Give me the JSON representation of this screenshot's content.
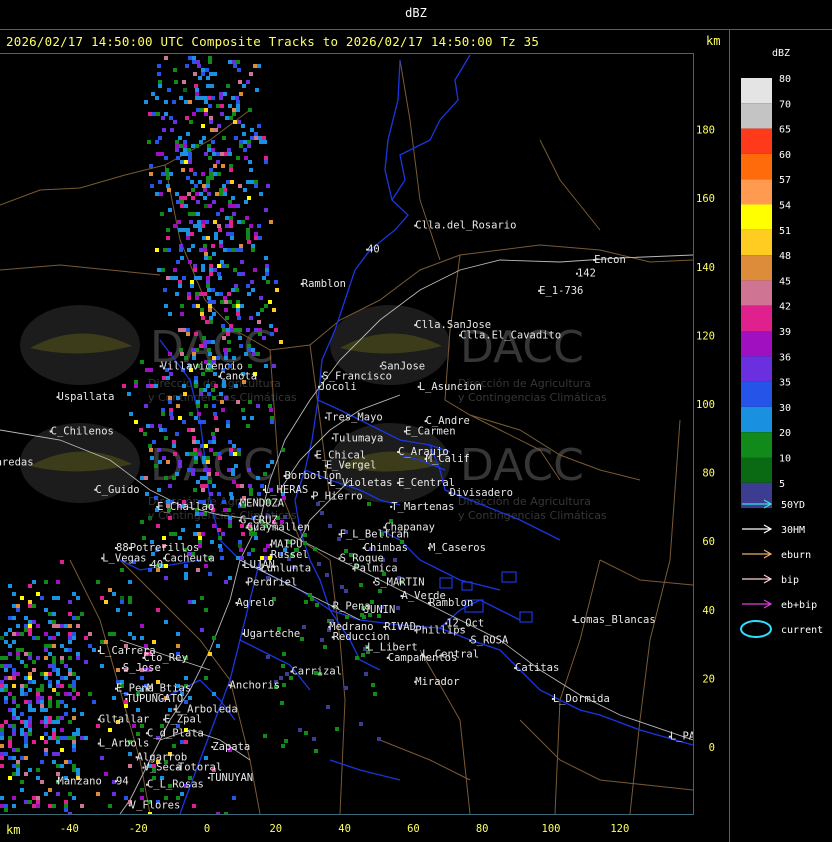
{
  "header": {
    "product": "dBZ"
  },
  "title": {
    "line": "2026/02/17 14:50:00 UTC Composite Tracks to 2026/02/17 14:50:00 Tz 35",
    "km_top": "km",
    "km_bottom": "km"
  },
  "watermark": {
    "brand": "DACC",
    "line1": "Dirección de Agricultura",
    "line2": "y Contingencias Climáticas"
  },
  "axes": {
    "x_ticks": [
      -40,
      -20,
      0,
      20,
      40,
      60,
      80,
      100,
      120
    ],
    "y_ticks": [
      180,
      160,
      140,
      120,
      100,
      80,
      60,
      40,
      20,
      0
    ],
    "x_range_km": [
      -60,
      142
    ],
    "y_range_km": [
      -20,
      200
    ]
  },
  "legend": {
    "title": "dBZ",
    "scale": [
      {
        "label": "80",
        "color": "#e4e4e4"
      },
      {
        "label": "70",
        "color": "#c4c4c4"
      },
      {
        "label": "65",
        "color": "#ff3a1a"
      },
      {
        "label": "60",
        "color": "#ff6a0a"
      },
      {
        "label": "57",
        "color": "#ff9a50"
      },
      {
        "label": "54",
        "color": "#ffff00"
      },
      {
        "label": "51",
        "color": "#ffcc22"
      },
      {
        "label": "48",
        "color": "#dd8c3a"
      },
      {
        "label": "45",
        "color": "#d07494"
      },
      {
        "label": "42",
        "color": "#e0208c"
      },
      {
        "label": "39",
        "color": "#a010c0"
      },
      {
        "label": "36",
        "color": "#6a30e0"
      },
      {
        "label": "35",
        "color": "#2454e8"
      },
      {
        "label": "30",
        "color": "#1a90e0"
      },
      {
        "label": "20",
        "color": "#118a1a"
      },
      {
        "label": "10",
        "color": "#0a6a14"
      },
      {
        "label": "5",
        "color": "#3c3c90"
      }
    ],
    "tracks": [
      {
        "label": "50YD",
        "color": "#40e0e0"
      },
      {
        "label": "30HM",
        "color": "#ffffff"
      },
      {
        "label": "eburn",
        "color": "#e8b070"
      },
      {
        "label": "bip",
        "color": "#ffd0d8"
      },
      {
        "label": "eb+bip",
        "color": "#e040e0"
      }
    ],
    "current": {
      "label": "current",
      "color": "#2ee0ff"
    }
  },
  "places": [
    {
      "name": "Clla.del_Rosario",
      "x": 62,
      "y": 152
    },
    {
      "name": "Encon",
      "x": 114,
      "y": 142
    },
    {
      "name": "142",
      "x": 109,
      "y": 138
    },
    {
      "name": "E_1-736",
      "x": 98,
      "y": 133
    },
    {
      "name": "Ramblon",
      "x": 29,
      "y": 135
    },
    {
      "name": "Clla.SanJose",
      "x": 62,
      "y": 123
    },
    {
      "name": "Clla.El_Cavadito",
      "x": 75,
      "y": 120
    },
    {
      "name": "Villavicencio",
      "x": -12,
      "y": 111
    },
    {
      "name": "S_Francisco",
      "x": 35,
      "y": 108
    },
    {
      "name": "SanJose",
      "x": 52,
      "y": 111
    },
    {
      "name": "Canota",
      "x": 5,
      "y": 108
    },
    {
      "name": "Jocoli",
      "x": 34,
      "y": 105
    },
    {
      "name": "L_Asuncion",
      "x": 63,
      "y": 105
    },
    {
      "name": "Uspallata",
      "x": -42,
      "y": 102
    },
    {
      "name": "Tres_Mayo",
      "x": 36,
      "y": 96
    },
    {
      "name": "C_Andre",
      "x": 65,
      "y": 95
    },
    {
      "name": "E_Carmen",
      "x": 59,
      "y": 92
    },
    {
      "name": "C_Chilenos",
      "x": -44,
      "y": 92
    },
    {
      "name": "Tulumaya",
      "x": 38,
      "y": 90
    },
    {
      "name": "C_Araujo",
      "x": 57,
      "y": 86
    },
    {
      "name": "E_Chical",
      "x": 33,
      "y": 85
    },
    {
      "name": "M_Calif",
      "x": 65,
      "y": 84
    },
    {
      "name": "E_Vergel",
      "x": 36,
      "y": 82
    },
    {
      "name": "Borbollon",
      "x": 24,
      "y": 79
    },
    {
      "name": "E_Central",
      "x": 57,
      "y": 77
    },
    {
      "name": "L_Violetas",
      "x": 37,
      "y": 77
    },
    {
      "name": "Divisadero",
      "x": 72,
      "y": 74
    },
    {
      "name": "L_HERAS",
      "x": 18,
      "y": 75
    },
    {
      "name": "C_Guido",
      "x": -31,
      "y": 75
    },
    {
      "name": "P_Hierro",
      "x": 32,
      "y": 73
    },
    {
      "name": "E_Challao",
      "x": -13,
      "y": 70
    },
    {
      "name": "MENDOZA",
      "x": 11,
      "y": 71
    },
    {
      "name": "T_Martenas",
      "x": 55,
      "y": 70
    },
    {
      "name": "G_CRUZ",
      "x": 11,
      "y": 66
    },
    {
      "name": "Chapanay",
      "x": 53,
      "y": 64
    },
    {
      "name": "Guaymallen",
      "x": 13,
      "y": 64
    },
    {
      "name": "F_L_Beltran",
      "x": 40,
      "y": 62
    },
    {
      "name": "MAIPU",
      "x": 20,
      "y": 59
    },
    {
      "name": "Chimbas",
      "x": 47,
      "y": 58
    },
    {
      "name": "M_Caseros",
      "x": 66,
      "y": 58
    },
    {
      "name": "Potrerillos",
      "x": -21,
      "y": 58
    },
    {
      "name": "Russel",
      "x": 20,
      "y": 56
    },
    {
      "name": "S_Roque",
      "x": 40,
      "y": 55
    },
    {
      "name": "L_Vegas",
      "x": -29,
      "y": 55
    },
    {
      "name": "Cacheuta",
      "x": -11,
      "y": 55
    },
    {
      "name": "LUJAN",
      "x": 12,
      "y": 53
    },
    {
      "name": "Lunlunta",
      "x": 17,
      "y": 52
    },
    {
      "name": "Palmica",
      "x": 44,
      "y": 52
    },
    {
      "name": "S_MARTIN",
      "x": 50,
      "y": 48
    },
    {
      "name": "Perdriel",
      "x": 13,
      "y": 48
    },
    {
      "name": "A_Verde",
      "x": 58,
      "y": 44
    },
    {
      "name": "Ramblon",
      "x": 66,
      "y": 42
    },
    {
      "name": "Agrelo",
      "x": 10,
      "y": 42
    },
    {
      "name": "R_Pena",
      "x": 38,
      "y": 41
    },
    {
      "name": "JUNIN",
      "x": 47,
      "y": 40
    },
    {
      "name": "Lomas_Blancas",
      "x": 108,
      "y": 37
    },
    {
      "name": "12_Oct",
      "x": 71,
      "y": 36
    },
    {
      "name": "RIVAD",
      "x": 53,
      "y": 35
    },
    {
      "name": "Phillips",
      "x": 62,
      "y": 34
    },
    {
      "name": "Medrano",
      "x": 37,
      "y": 35
    },
    {
      "name": "Ugarteche",
      "x": 12,
      "y": 33
    },
    {
      "name": "Reduccion",
      "x": 38,
      "y": 32
    },
    {
      "name": "S_ROSA",
      "x": 78,
      "y": 31
    },
    {
      "name": "L_Libert",
      "x": 48,
      "y": 29
    },
    {
      "name": "L_Carrera",
      "x": -30,
      "y": 28
    },
    {
      "name": "Cto_Rey",
      "x": -17,
      "y": 26
    },
    {
      "name": "L_Central",
      "x": 64,
      "y": 27
    },
    {
      "name": "Campamentos",
      "x": 54,
      "y": 26
    },
    {
      "name": "S_Jose",
      "x": -23,
      "y": 23
    },
    {
      "name": "Catitas",
      "x": 91,
      "y": 23
    },
    {
      "name": "Carrizal",
      "x": 26,
      "y": 22
    },
    {
      "name": "Anchoris",
      "x": 8,
      "y": 18
    },
    {
      "name": "Mirador",
      "x": 62,
      "y": 19
    },
    {
      "name": "M_Btias",
      "x": -16,
      "y": 17
    },
    {
      "name": "E_Pena",
      "x": -25,
      "y": 17
    },
    {
      "name": "TUPUNGATO",
      "x": -22,
      "y": 14
    },
    {
      "name": "L_Dormida",
      "x": 102,
      "y": 14
    },
    {
      "name": "L_Arboleda",
      "x": -8,
      "y": 11
    },
    {
      "name": "Gltallar",
      "x": -30,
      "y": 8
    },
    {
      "name": "E_Zpal",
      "x": -11,
      "y": 8
    },
    {
      "name": "C_d_Plata",
      "x": -16,
      "y": 4
    },
    {
      "name": "L_PAZ",
      "x": 136,
      "y": 3
    },
    {
      "name": "L_Arbols",
      "x": -30,
      "y": 1
    },
    {
      "name": "Zapata",
      "x": 3,
      "y": 0
    },
    {
      "name": "Algarrob",
      "x": -19,
      "y": -3
    },
    {
      "name": "V_Seca",
      "x": -17,
      "y": -6
    },
    {
      "name": "Totoral",
      "x": -7,
      "y": -6
    },
    {
      "name": "TUNUYAN",
      "x": 2,
      "y": -9
    },
    {
      "name": "Manzano",
      "x": -42,
      "y": -10
    },
    {
      "name": "C_L_Rosas",
      "x": -16,
      "y": -11
    },
    {
      "name": "V_Flores",
      "x": -21,
      "y": -17
    },
    {
      "name": "aredas",
      "x": -60,
      "y": 83
    },
    {
      "name": "40",
      "x": 48,
      "y": 145
    },
    {
      "name": "88",
      "x": -25,
      "y": 58
    },
    {
      "name": "40",
      "x": -15,
      "y": 53
    },
    {
      "name": "94",
      "x": -25,
      "y": -10
    }
  ]
}
